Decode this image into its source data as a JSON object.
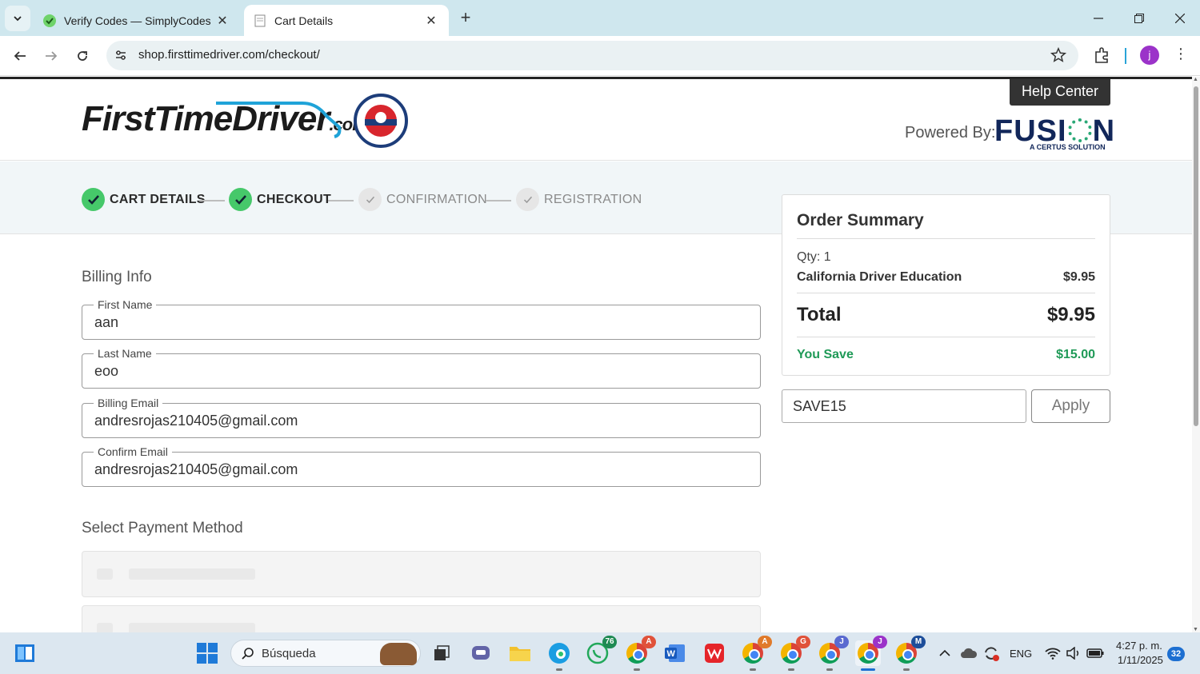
{
  "browser": {
    "tabs": [
      {
        "label": "Verify Codes — SimplyCodes",
        "active": false
      },
      {
        "label": "Cart Details",
        "active": true
      }
    ],
    "url": "shop.firsttimedriver.com/checkout/",
    "profile_initial": "j"
  },
  "header": {
    "logo_main": "FirstTimeDriver",
    "logo_com": ".com",
    "help_center": "Help Center",
    "powered_by": "Powered By:",
    "fusion": "FUSI",
    "fusion_n": "N",
    "fusion_sub": "A CERTUS SOLUTION"
  },
  "steps": [
    {
      "label": "CART DETAILS",
      "status": "done"
    },
    {
      "label": "CHECKOUT",
      "status": "done"
    },
    {
      "label": "CONFIRMATION",
      "status": "todo"
    },
    {
      "label": "REGISTRATION",
      "status": "todo"
    }
  ],
  "billing": {
    "title": "Billing Info",
    "first_name_label": "First Name",
    "first_name": "aan",
    "last_name_label": "Last Name",
    "last_name": "eoo",
    "email_label": "Billing Email",
    "email": "andresrojas210405@gmail.com",
    "confirm_email_label": "Confirm Email",
    "confirm_email": "andresrojas210405@gmail.com"
  },
  "payment": {
    "title": "Select Payment Method"
  },
  "order_summary": {
    "title": "Order Summary",
    "qty": "Qty: 1",
    "item": "California Driver Education",
    "item_price": "$9.95",
    "total_label": "Total",
    "total": "$9.95",
    "save_label": "You Save",
    "save": "$15.00"
  },
  "coupon": {
    "value": "SAVE15",
    "apply_label": "Apply"
  },
  "taskbar": {
    "search_label": "Búsqueda",
    "whatsapp_badge": "76",
    "chrome_badges": [
      "A",
      "A",
      "G",
      "J",
      "J",
      "M"
    ],
    "language": "ENG",
    "time": "4:27 p. m.",
    "date": "1/11/2025",
    "notifications": "32"
  },
  "colors": {
    "accent_green": "#46c86a",
    "save_green": "#1f9a57",
    "fusion_navy": "#12275a",
    "tabbar": "#cfe7ee"
  }
}
